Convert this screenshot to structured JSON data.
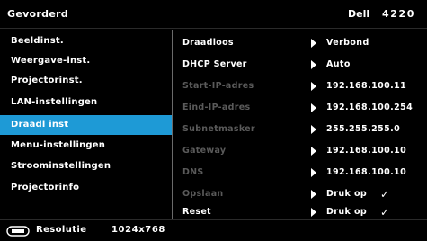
{
  "header": {
    "title": "Gevorderd",
    "brand": "Dell",
    "model": "4220"
  },
  "left_menu": {
    "items": [
      {
        "label": "Beeldinst."
      },
      {
        "label": "Weergave-inst."
      },
      {
        "label": "Projectorinst."
      },
      {
        "label": "LAN-instellingen"
      },
      {
        "label": "Draadl inst",
        "selected": true
      },
      {
        "label": "Menu-instellingen"
      },
      {
        "label": "Stroominstellingen"
      },
      {
        "label": "Projectorinfo"
      }
    ]
  },
  "right_panel": {
    "rows": [
      {
        "label": "Draadloos",
        "value": "Verbond",
        "state": "active"
      },
      {
        "label": "DHCP Server",
        "value": "Auto",
        "state": "active"
      },
      {
        "label": "Start-IP-adres",
        "value": "192.168.100.11",
        "state": "dim"
      },
      {
        "label": "Eind-IP-adres",
        "value": "192.168.100.254",
        "state": "dim"
      },
      {
        "label": "Subnetmasker",
        "value": "255.255.255.0",
        "state": "dim"
      },
      {
        "label": "Gateway",
        "value": "192.168.100.10",
        "state": "dim"
      },
      {
        "label": "DNS",
        "value": "192.168.100.10",
        "state": "dim"
      },
      {
        "label": "Opslaan",
        "value": "Druk op",
        "check": "✓",
        "state": "dim"
      },
      {
        "label": "Reset",
        "value": "Druk op",
        "check": "✓",
        "state": "active"
      }
    ]
  },
  "footer": {
    "icon": "display-input-icon",
    "label": "Resolutie",
    "value": "1024x768"
  },
  "colors": {
    "selected": "#1e9ad6",
    "dim_text": "#5a5a5a",
    "frame": "#6a6a6a"
  }
}
